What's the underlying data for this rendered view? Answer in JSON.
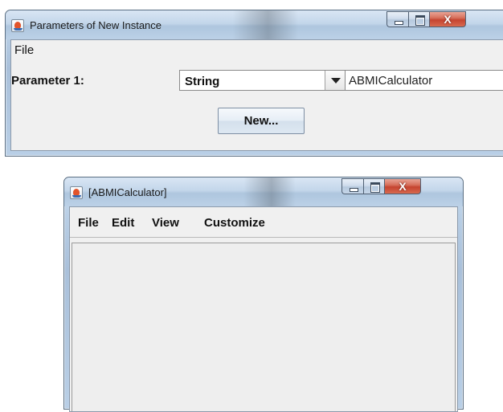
{
  "window1": {
    "title": "Parameters of New Instance",
    "menu": {
      "file": "File"
    },
    "param_label": "Parameter 1:",
    "type_select": {
      "value": "String"
    },
    "value_field": {
      "value": "ABMICalculator"
    },
    "new_button": "New...",
    "close_glyph": "X"
  },
  "window2": {
    "title": "[ABMICalculator]",
    "menu": {
      "file": "File",
      "edit": "Edit",
      "view": "View",
      "customize": "Customize"
    },
    "close_glyph": "X"
  },
  "colors": {
    "titlebar": "#bcd1e7",
    "close_button": "#c54430",
    "client_background": "#f0f0f0"
  }
}
